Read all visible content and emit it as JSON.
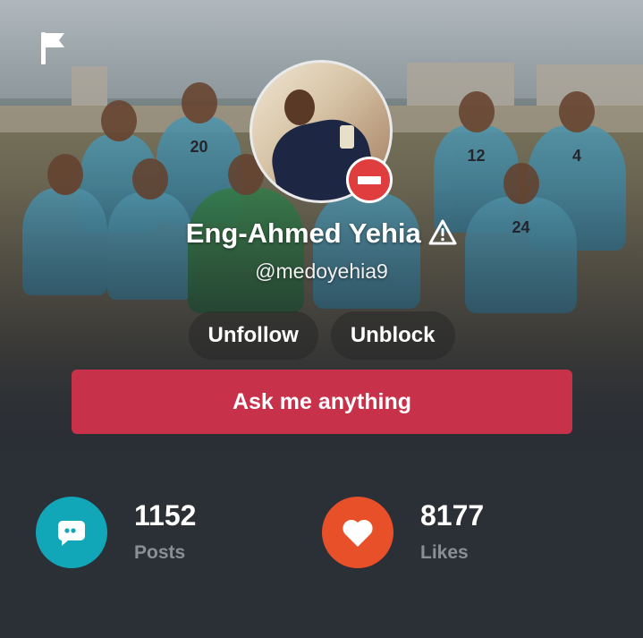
{
  "profile": {
    "name": "Eng-Ahmed Yehia",
    "handle": "@medoyehia9"
  },
  "actions": {
    "unfollow_label": "Unfollow",
    "unblock_label": "Unblock",
    "ask_label": "Ask me anything"
  },
  "stats": {
    "posts": {
      "count": "1152",
      "label": "Posts",
      "icon": "chat-bubble-icon",
      "color": "#12a7b8"
    },
    "likes": {
      "count": "8177",
      "label": "Likes",
      "icon": "heart-icon",
      "color": "#e8502a"
    }
  },
  "colors": {
    "ask_button": "#c7314a",
    "blocked_badge": "#e03e3e",
    "background": "#2b2f36"
  },
  "icons": {
    "top_left": "flag-icon",
    "name_suffix": "warning-icon",
    "avatar_badge": "blocked-icon"
  }
}
